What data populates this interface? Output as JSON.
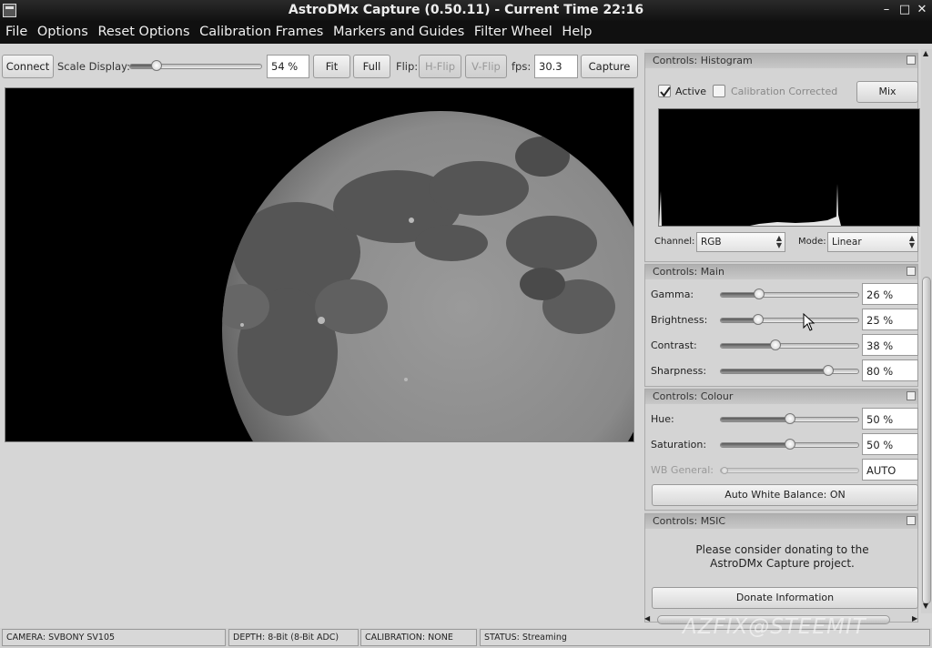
{
  "window": {
    "title": "AstroDMx Capture (0.50.11) - Current Time 22:16"
  },
  "menu": [
    "File",
    "Options",
    "Reset Options",
    "Calibration Frames",
    "Markers and Guides",
    "Filter Wheel",
    "Help"
  ],
  "toolbar": {
    "connect": "Connect",
    "scale_label": "Scale Display:",
    "scale_value": "54 %",
    "scale_level": 0.2,
    "fit": "Fit",
    "full": "Full",
    "flip_label": "Flip:",
    "hflip": "H-Flip",
    "vflip": "V-Flip",
    "fps_label": "fps:",
    "fps_value": "30.3",
    "capture": "Capture"
  },
  "histogram": {
    "title": "Controls: Histogram",
    "active": "Active",
    "calibration": "Calibration Corrected",
    "mix": "Mix",
    "channel_label": "Channel:",
    "channel_value": "RGB",
    "mode_label": "Mode:",
    "mode_value": "Linear"
  },
  "main": {
    "title": "Controls: Main",
    "sliders": [
      {
        "label": "Gamma:",
        "value": "26 %",
        "level": 0.28
      },
      {
        "label": "Brightness:",
        "value": "25 %",
        "level": 0.27
      },
      {
        "label": "Contrast:",
        "value": "38 %",
        "level": 0.4
      },
      {
        "label": "Sharpness:",
        "value": "80 %",
        "level": 0.78
      }
    ]
  },
  "colour": {
    "title": "Controls: Colour",
    "sliders": [
      {
        "label": "Hue:",
        "value": "50 %",
        "level": 0.5
      },
      {
        "label": "Saturation:",
        "value": "50 %",
        "level": 0.5
      },
      {
        "label": "WB General:",
        "value": "AUTO",
        "level": 0.0
      }
    ],
    "awb": "Auto White Balance: ON"
  },
  "msic": {
    "title": "Controls: MSIC",
    "donate_text_1": "Please consider donating to the",
    "donate_text_2": "AstroDMx Capture project.",
    "donate_button": "Donate Information"
  },
  "status": {
    "camera": "CAMERA: SVBONY SV105",
    "depth": "DEPTH: 8-Bit (8-Bit ADC)",
    "calibration": "CALIBRATION: NONE",
    "status": "STATUS: Streaming"
  },
  "watermark": "AZFIX@STEEMIT"
}
